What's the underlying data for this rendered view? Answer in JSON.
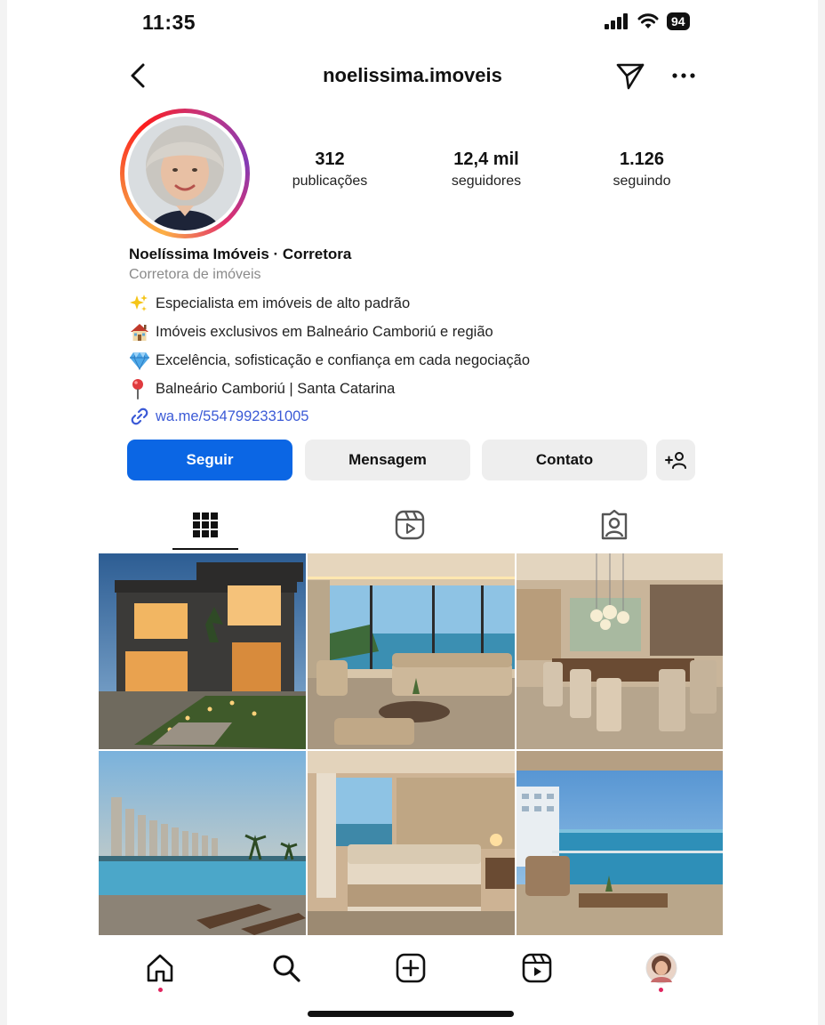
{
  "status": {
    "time": "11:35",
    "battery": "94"
  },
  "header": {
    "username": "noelissima.imoveis"
  },
  "stats": [
    {
      "value": "312",
      "label": "publicações"
    },
    {
      "value": "12,4 mil",
      "label": "seguidores"
    },
    {
      "value": "1.126",
      "label": "seguindo"
    }
  ],
  "bio": {
    "name": "Noelíssima Imóveis · Corretora",
    "category": "Corretora de imóveis",
    "lines": [
      {
        "icon": "sparkles-icon",
        "text": "Especialista em imóveis de alto padrão"
      },
      {
        "icon": "house-icon",
        "text": "Imóveis exclusivos em Balneário Camboriú e região"
      },
      {
        "icon": "diamond-icon",
        "text": "Excelência, sofisticação e confiança em cada negociação"
      },
      {
        "icon": "pin-icon",
        "text": "Balneário Camboriú | Santa Catarina"
      }
    ],
    "link": "wa.me/5547992331005"
  },
  "buttons": {
    "follow": "Seguir",
    "message": "Mensagem",
    "contact": "Contato",
    "add": "+👤"
  },
  "accent": {
    "primary": "#0b66e4",
    "link": "#3b5ad6",
    "notification": "#e0245e"
  }
}
